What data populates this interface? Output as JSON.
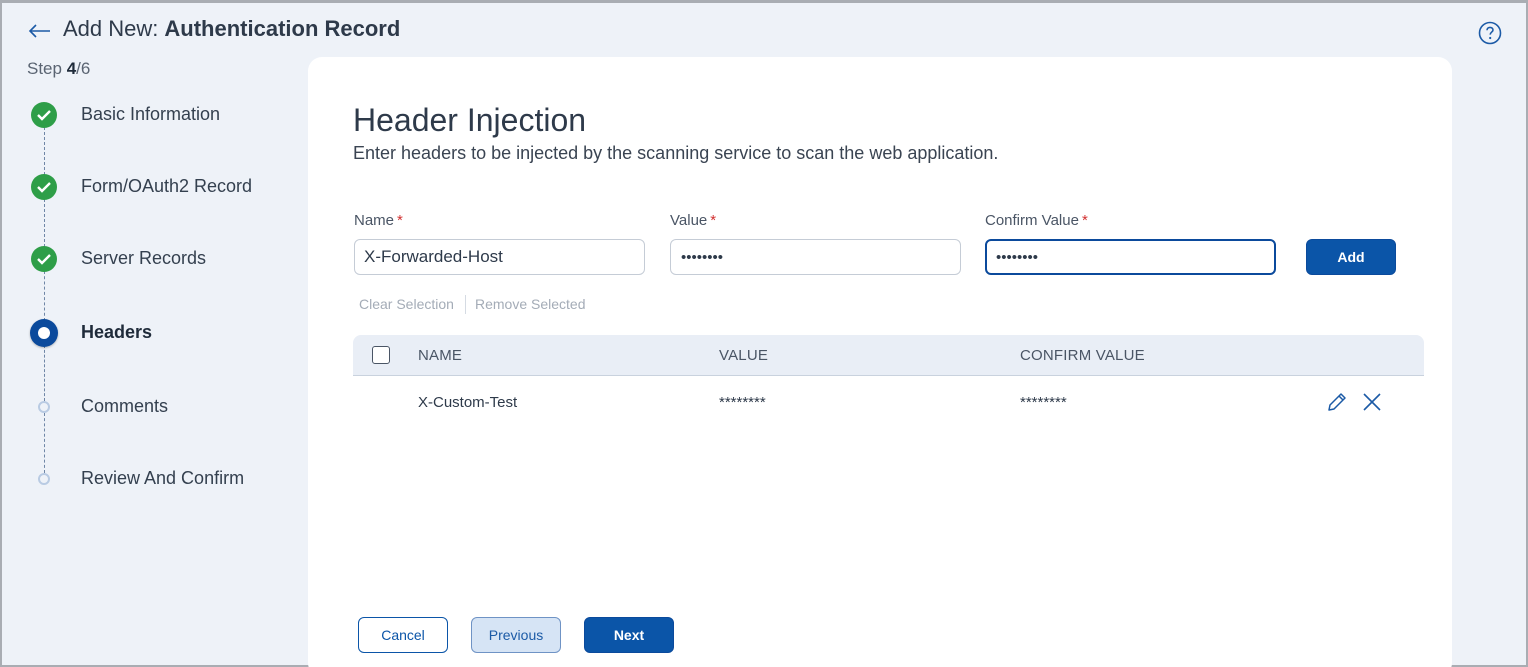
{
  "header": {
    "title_prefix": "Add New:",
    "title_main": "Authentication Record",
    "step_current": "4",
    "step_total": "/6",
    "step_prefix": "Step "
  },
  "stepper": {
    "steps": [
      {
        "label": "Basic Information",
        "state": "done"
      },
      {
        "label": "Form/OAuth2 Record",
        "state": "done"
      },
      {
        "label": "Server Records",
        "state": "done"
      },
      {
        "label": "Headers",
        "state": "current"
      },
      {
        "label": "Comments",
        "state": "future"
      },
      {
        "label": "Review And Confirm",
        "state": "future"
      }
    ]
  },
  "form": {
    "title": "Header Injection",
    "description": "Enter headers to be injected by the scanning service to scan the web application.",
    "name_label": "Name",
    "value_label": "Value",
    "confirm_label": "Confirm Value",
    "required_mark": "*",
    "name_value": "X-Forwarded-Host",
    "value_masked": "••••••••",
    "confirm_masked": "••••••••",
    "add_button": "Add",
    "clear_selection": "Clear Selection",
    "remove_selected": "Remove Selected"
  },
  "table": {
    "columns": [
      "NAME",
      "VALUE",
      "CONFIRM VALUE"
    ],
    "rows": [
      {
        "name": "X-Custom-Test",
        "value": "********",
        "confirm": "********"
      }
    ]
  },
  "footer": {
    "cancel": "Cancel",
    "previous": "Previous",
    "next": "Next"
  },
  "colors": {
    "primary": "#0b55a8",
    "success": "#2e9e48",
    "required": "#d23030"
  },
  "icons": [
    "back-arrow-icon",
    "help-icon",
    "check-icon",
    "edit-icon",
    "close-icon"
  ]
}
